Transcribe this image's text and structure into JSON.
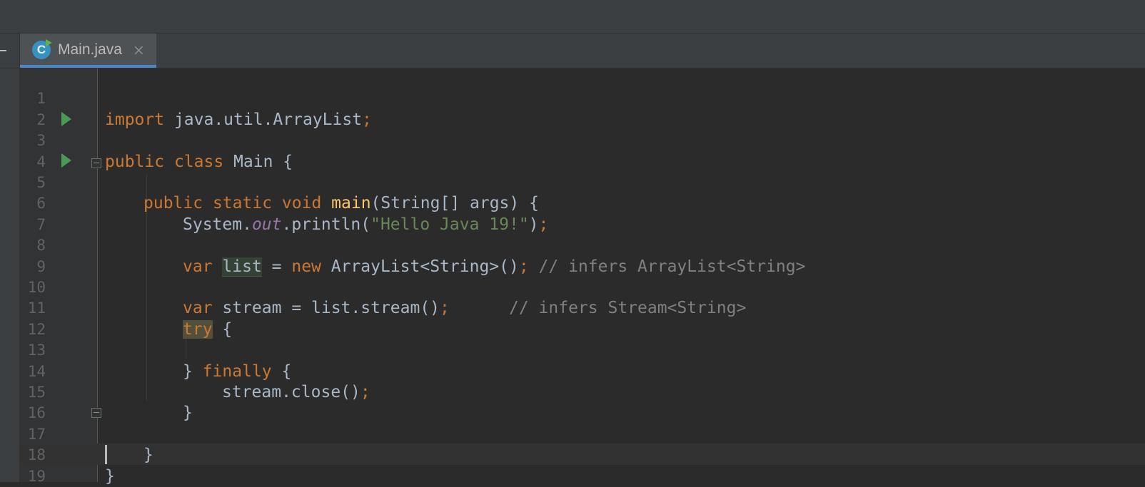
{
  "tab": {
    "filename": "Main.java",
    "icon": "java-class-icon",
    "class_letter": "C",
    "close_glyph": "×"
  },
  "colors": {
    "keyword": "#cc7832",
    "string": "#6a8759",
    "comment": "#808080",
    "method_decl": "#ffc66d",
    "static_field": "#9876aa",
    "default_text": "#a9b7c6",
    "tab_underline": "#4a88c7"
  },
  "gutter": {
    "line_numbers": [
      "1",
      "2",
      "3",
      "4",
      "5",
      "6",
      "7",
      "8",
      "9",
      "10",
      "11",
      "12",
      "13",
      "14",
      "15",
      "16",
      "17",
      "18",
      "19"
    ],
    "run_markers_on_lines": [
      3,
      5
    ],
    "fold_markers_on_lines": [
      5,
      17
    ]
  },
  "code": {
    "l1": {
      "kw": "import",
      "rest": " java.util.ArrayList",
      "semi": ";"
    },
    "l3": {
      "kw1": "public",
      "kw2": "class",
      "rest": " Main {"
    },
    "l5": {
      "kw1": "public",
      "kw2": "static",
      "kw3": "void",
      "fn": "main",
      "rest": "(String[] args) {"
    },
    "l6": {
      "pre": "System.",
      "field": "out",
      "mid": ".println(",
      "str": "\"Hello Java 19!\"",
      "post": ")",
      "semi": ";"
    },
    "l8": {
      "kw": "var",
      "var": "list",
      "eq": " = ",
      "kw2": "new",
      "rest": " ArrayList<String>()",
      "semi": ";",
      "comment": " // infers ArrayList<String>"
    },
    "l10": {
      "kw": "var",
      "rest": " stream = list.stream()",
      "semi": ";",
      "gap": "      ",
      "comment": "// infers Stream<String>"
    },
    "l11": {
      "kw": "try",
      "rest": " {"
    },
    "l13": {
      "pre": "} ",
      "kw": "finally",
      "rest": " {"
    },
    "l14": {
      "rest": "stream.close()",
      "semi": ";"
    },
    "l15": {
      "rest": "}"
    },
    "l17": {
      "rest": "}"
    },
    "l18": {
      "rest": "}"
    }
  }
}
